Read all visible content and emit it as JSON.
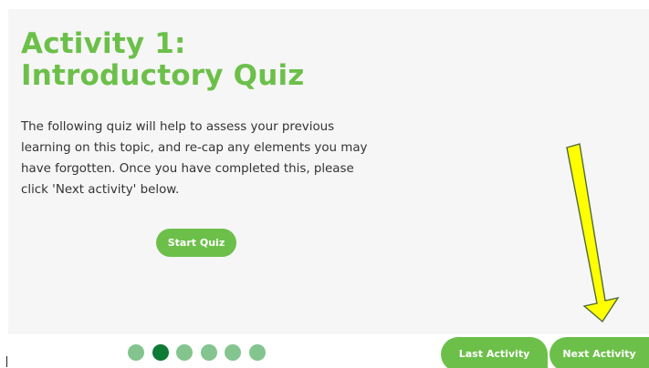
{
  "activity": {
    "title_line1": "Activity 1:",
    "title_line2": "Introductory Quiz",
    "description": "The following quiz will help to assess your previous learning on this topic, and re-cap any elements you may have forgotten. Once you have completed this, please click 'Next activity' below.",
    "start_button_label": "Start Quiz"
  },
  "pagination": {
    "total": 6,
    "active_index": 1
  },
  "navigation": {
    "last_label": "Last Activity",
    "next_label": "Next Activity"
  },
  "colors": {
    "accent": "#6cc04a",
    "panel_background": "#f6f6f6",
    "dot_inactive": "#83c48f",
    "dot_active": "#0d7a35",
    "annotation_arrow": "#ffff00"
  }
}
